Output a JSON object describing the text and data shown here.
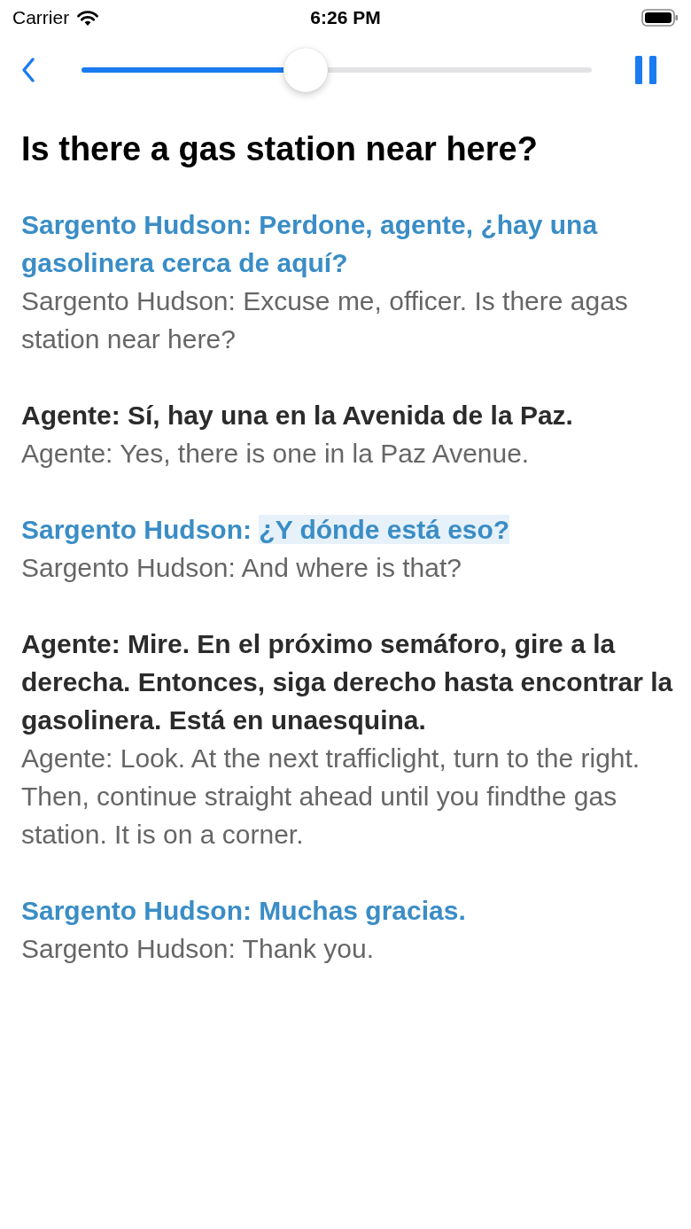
{
  "status_bar": {
    "carrier": "Carrier",
    "time": "6:26 PM"
  },
  "player": {
    "level": 0.44,
    "playing": true
  },
  "title": "Is there a gas station near here?",
  "dialogue": [
    {
      "speaker": "Sargento Hudson:",
      "line": "Perdone, agente, ¿hay una gasolinera cerca de aquí?",
      "translation": "Sargento Hudson: Excuse me, officer. Is there agas station near here?",
      "color": "#3a8dc6",
      "highlighted": false
    },
    {
      "speaker": "Agente:",
      "line": "Sí, hay una en la Avenida de la Paz.",
      "translation": "Agente: Yes, there is one in la Paz Avenue.",
      "color": "#2b2b2b",
      "highlighted": false
    },
    {
      "speaker": "Sargento Hudson:",
      "line": "¿Y dónde está eso?",
      "translation": "Sargento Hudson: And where is that?",
      "color": "#3a8dc6",
      "highlighted": true
    },
    {
      "speaker": "Agente:",
      "line": "Mire. En el próximo semáforo, gire a la derecha. Entonces, siga derecho hasta encontrar la gasolinera. Está en unaesquina.",
      "translation": "Agente: Look. At the next trafficlight, turn to the right. Then, continue straight ahead until you findthe gas station. It is on a corner.",
      "color": "#2b2b2b",
      "highlighted": false
    },
    {
      "speaker": "Sargento Hudson:",
      "line": "Muchas gracias.",
      "translation": "Sargento Hudson: Thank you.",
      "color": "#3a8dc6",
      "highlighted": false
    }
  ]
}
